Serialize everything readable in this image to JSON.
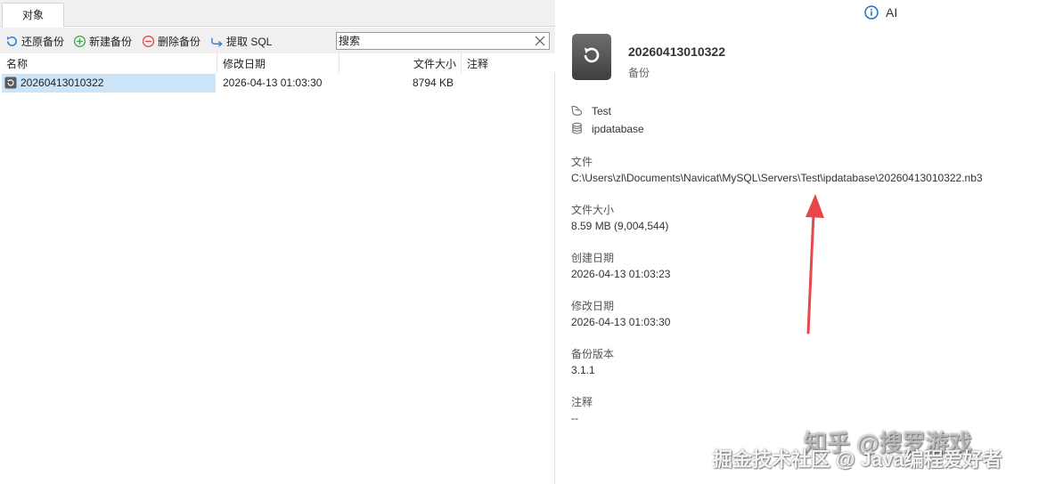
{
  "tabs": [
    {
      "label": "对象"
    }
  ],
  "toolbar": {
    "restore": "还原备份",
    "new": "新建备份",
    "delete": "删除备份",
    "extract": "提取 SQL",
    "search_placeholder": "搜索"
  },
  "table": {
    "headers": [
      "名称",
      "修改日期",
      "文件大小",
      "注释"
    ],
    "rows": [
      {
        "name": "20260413010322",
        "modified": "2026-04-13 01:03:30",
        "size": "8794 KB",
        "comment": ""
      }
    ]
  },
  "detail": {
    "ai_label": "AI",
    "title": "20260413010322",
    "subtitle": "备份",
    "connection": "Test",
    "database": "ipdatabase",
    "props": [
      {
        "label": "文件",
        "value": "C:\\Users\\zl\\Documents\\Navicat\\MySQL\\Servers\\Test\\ipdatabase\\20260413010322.nb3"
      },
      {
        "label": "文件大小",
        "value": "8.59 MB (9,004,544)"
      },
      {
        "label": "创建日期",
        "value": "2026-04-13 01:03:23"
      },
      {
        "label": "修改日期",
        "value": "2026-04-13 01:03:30"
      },
      {
        "label": "备份版本",
        "value": "3.1.1"
      },
      {
        "label": "注释",
        "value": "--"
      }
    ]
  },
  "watermarks": [
    "知乎 @搜罗游戏",
    "掘金技术社区 @ Java编程爱好者"
  ],
  "colors": {
    "selection": "#cce4f7",
    "arrow": "#e8474a",
    "toolbar_bg": "#f0f0f0"
  }
}
